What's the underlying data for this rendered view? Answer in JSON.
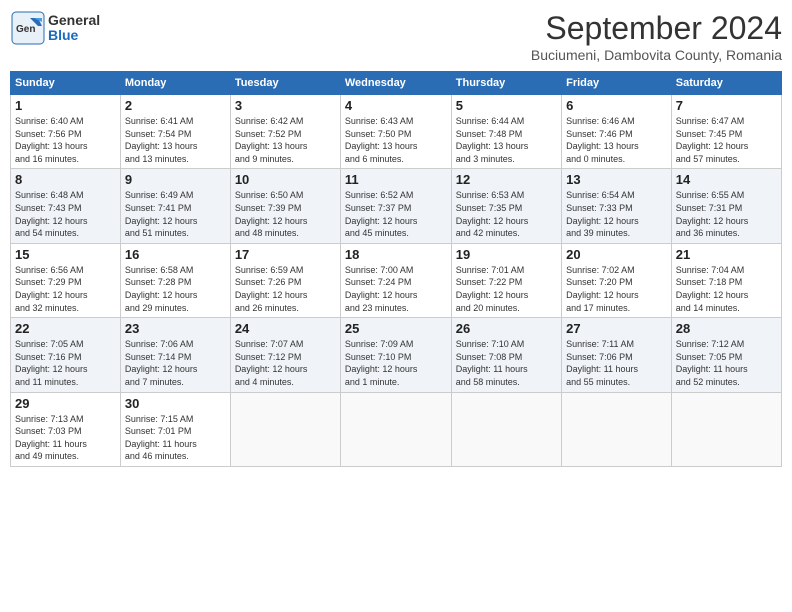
{
  "header": {
    "logo_general": "General",
    "logo_blue": "Blue",
    "title": "September 2024",
    "location": "Buciumeni, Dambovita County, Romania"
  },
  "columns": [
    "Sunday",
    "Monday",
    "Tuesday",
    "Wednesday",
    "Thursday",
    "Friday",
    "Saturday"
  ],
  "weeks": [
    [
      {
        "day": 1,
        "info": "Sunrise: 6:40 AM\nSunset: 7:56 PM\nDaylight: 13 hours\nand 16 minutes."
      },
      {
        "day": 2,
        "info": "Sunrise: 6:41 AM\nSunset: 7:54 PM\nDaylight: 13 hours\nand 13 minutes."
      },
      {
        "day": 3,
        "info": "Sunrise: 6:42 AM\nSunset: 7:52 PM\nDaylight: 13 hours\nand 9 minutes."
      },
      {
        "day": 4,
        "info": "Sunrise: 6:43 AM\nSunset: 7:50 PM\nDaylight: 13 hours\nand 6 minutes."
      },
      {
        "day": 5,
        "info": "Sunrise: 6:44 AM\nSunset: 7:48 PM\nDaylight: 13 hours\nand 3 minutes."
      },
      {
        "day": 6,
        "info": "Sunrise: 6:46 AM\nSunset: 7:46 PM\nDaylight: 13 hours\nand 0 minutes."
      },
      {
        "day": 7,
        "info": "Sunrise: 6:47 AM\nSunset: 7:45 PM\nDaylight: 12 hours\nand 57 minutes."
      }
    ],
    [
      {
        "day": 8,
        "info": "Sunrise: 6:48 AM\nSunset: 7:43 PM\nDaylight: 12 hours\nand 54 minutes."
      },
      {
        "day": 9,
        "info": "Sunrise: 6:49 AM\nSunset: 7:41 PM\nDaylight: 12 hours\nand 51 minutes."
      },
      {
        "day": 10,
        "info": "Sunrise: 6:50 AM\nSunset: 7:39 PM\nDaylight: 12 hours\nand 48 minutes."
      },
      {
        "day": 11,
        "info": "Sunrise: 6:52 AM\nSunset: 7:37 PM\nDaylight: 12 hours\nand 45 minutes."
      },
      {
        "day": 12,
        "info": "Sunrise: 6:53 AM\nSunset: 7:35 PM\nDaylight: 12 hours\nand 42 minutes."
      },
      {
        "day": 13,
        "info": "Sunrise: 6:54 AM\nSunset: 7:33 PM\nDaylight: 12 hours\nand 39 minutes."
      },
      {
        "day": 14,
        "info": "Sunrise: 6:55 AM\nSunset: 7:31 PM\nDaylight: 12 hours\nand 36 minutes."
      }
    ],
    [
      {
        "day": 15,
        "info": "Sunrise: 6:56 AM\nSunset: 7:29 PM\nDaylight: 12 hours\nand 32 minutes."
      },
      {
        "day": 16,
        "info": "Sunrise: 6:58 AM\nSunset: 7:28 PM\nDaylight: 12 hours\nand 29 minutes."
      },
      {
        "day": 17,
        "info": "Sunrise: 6:59 AM\nSunset: 7:26 PM\nDaylight: 12 hours\nand 26 minutes."
      },
      {
        "day": 18,
        "info": "Sunrise: 7:00 AM\nSunset: 7:24 PM\nDaylight: 12 hours\nand 23 minutes."
      },
      {
        "day": 19,
        "info": "Sunrise: 7:01 AM\nSunset: 7:22 PM\nDaylight: 12 hours\nand 20 minutes."
      },
      {
        "day": 20,
        "info": "Sunrise: 7:02 AM\nSunset: 7:20 PM\nDaylight: 12 hours\nand 17 minutes."
      },
      {
        "day": 21,
        "info": "Sunrise: 7:04 AM\nSunset: 7:18 PM\nDaylight: 12 hours\nand 14 minutes."
      }
    ],
    [
      {
        "day": 22,
        "info": "Sunrise: 7:05 AM\nSunset: 7:16 PM\nDaylight: 12 hours\nand 11 minutes."
      },
      {
        "day": 23,
        "info": "Sunrise: 7:06 AM\nSunset: 7:14 PM\nDaylight: 12 hours\nand 7 minutes."
      },
      {
        "day": 24,
        "info": "Sunrise: 7:07 AM\nSunset: 7:12 PM\nDaylight: 12 hours\nand 4 minutes."
      },
      {
        "day": 25,
        "info": "Sunrise: 7:09 AM\nSunset: 7:10 PM\nDaylight: 12 hours\nand 1 minute."
      },
      {
        "day": 26,
        "info": "Sunrise: 7:10 AM\nSunset: 7:08 PM\nDaylight: 11 hours\nand 58 minutes."
      },
      {
        "day": 27,
        "info": "Sunrise: 7:11 AM\nSunset: 7:06 PM\nDaylight: 11 hours\nand 55 minutes."
      },
      {
        "day": 28,
        "info": "Sunrise: 7:12 AM\nSunset: 7:05 PM\nDaylight: 11 hours\nand 52 minutes."
      }
    ],
    [
      {
        "day": 29,
        "info": "Sunrise: 7:13 AM\nSunset: 7:03 PM\nDaylight: 11 hours\nand 49 minutes."
      },
      {
        "day": 30,
        "info": "Sunrise: 7:15 AM\nSunset: 7:01 PM\nDaylight: 11 hours\nand 46 minutes."
      },
      null,
      null,
      null,
      null,
      null
    ]
  ]
}
